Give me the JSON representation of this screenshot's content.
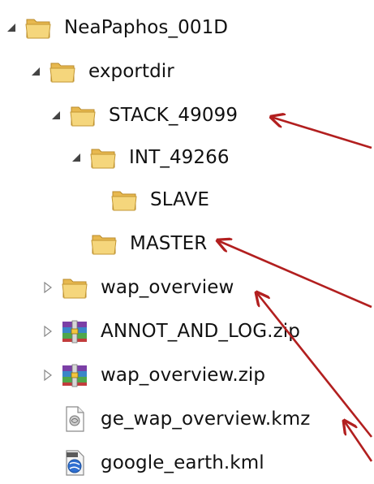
{
  "tree": {
    "items": [
      {
        "label": "NeaPaphos_001D",
        "state": "expanded",
        "type": "folder"
      },
      {
        "label": "exportdir",
        "state": "expanded",
        "type": "folder"
      },
      {
        "label": "STACK_49099",
        "state": "expanded",
        "type": "folder"
      },
      {
        "label": "INT_49266",
        "state": "expanded",
        "type": "folder"
      },
      {
        "label": "SLAVE",
        "state": "leaf",
        "type": "folder"
      },
      {
        "label": "MASTER",
        "state": "leaf",
        "type": "folder"
      },
      {
        "label": "wap_overview",
        "state": "collapsed",
        "type": "folder"
      },
      {
        "label": "ANNOT_AND_LOG.zip",
        "state": "collapsed",
        "type": "zip-archive"
      },
      {
        "label": "wap_overview.zip",
        "state": "collapsed",
        "type": "zip-archive"
      },
      {
        "label": "ge_wap_overview.kmz",
        "state": "leaf",
        "type": "kmz-file"
      },
      {
        "label": "google_earth.kml",
        "state": "leaf",
        "type": "kml-file"
      }
    ]
  },
  "annotation_color": "#b21f1f",
  "icons": {
    "expanded_toggle": "expanded-triangle-icon",
    "collapsed_toggle": "collapsed-triangle-icon",
    "folder": "folder-icon",
    "zip": "zip-archive-icon",
    "kmz": "kmz-file-icon",
    "kml": "kml-file-icon"
  }
}
